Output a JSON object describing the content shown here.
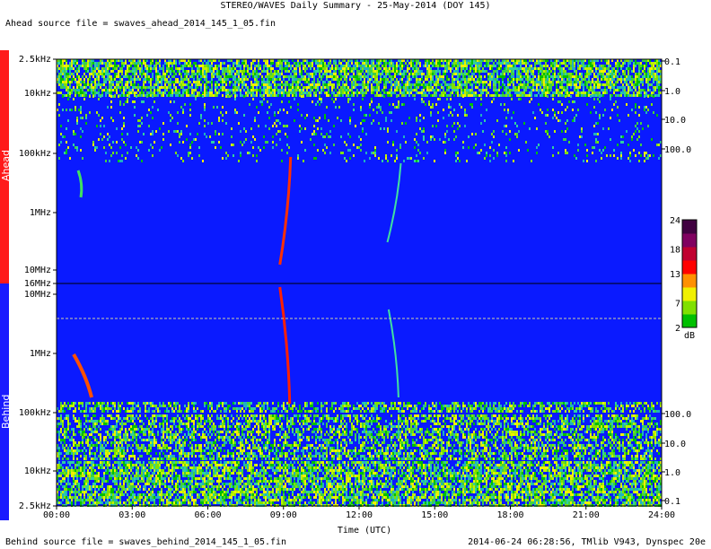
{
  "header": {
    "title": "STEREO/WAVES Daily Summary - 25-May-2014 (DOY 145)",
    "ahead_source": "Ahead source file = swaves_ahead_2014_145_1_05.fin",
    "behind_source": "Behind source file = swaves_behind_2014_145_1_05.fin",
    "footer_right": "2014-06-24 06:28:56, TMlib V943, Dynspec 20e"
  },
  "panels": {
    "ahead_label": "Ahead",
    "behind_label": "Behind"
  },
  "chart_data": {
    "type": "heatmap",
    "title": "STEREO/WAVES Daily Summary - 25-May-2014 (DOY 145)",
    "xlabel": "Time (UTC)",
    "x_ticks": [
      "00:00",
      "03:00",
      "06:00",
      "09:00",
      "12:00",
      "15:00",
      "18:00",
      "21:00",
      "24:00"
    ],
    "xlim_hours": [
      0,
      24
    ],
    "ahead_freq_ticks": [
      "2.5kHz",
      "10kHz",
      "100kHz",
      "1MHz",
      "10MHz",
      "16MHz"
    ],
    "behind_freq_ticks": [
      "16MHz",
      "10MHz",
      "1MHz",
      "100kHz",
      "10kHz",
      "2.5kHz"
    ],
    "ahead_right_ticks": [
      "0.1",
      "1.0",
      "10.0",
      "100.0"
    ],
    "behind_right_ticks": [
      "100.0",
      "10.0",
      "1.0",
      "0.1"
    ],
    "colorbar": {
      "ticks": [
        24,
        18,
        13,
        7,
        2
      ],
      "unit": "dB",
      "range": [
        2,
        24
      ],
      "colors": [
        "#00c000",
        "#80e000",
        "#f0f000",
        "#ff9000",
        "#ff0000",
        "#c00030",
        "#800060",
        "#400040"
      ]
    },
    "background_color": "#0a1aff",
    "events_hours": {
      "ahead_bursts": [
        0.5,
        8.75,
        13.3
      ],
      "behind_bursts": [
        0.5,
        8.75,
        13.1
      ]
    }
  }
}
